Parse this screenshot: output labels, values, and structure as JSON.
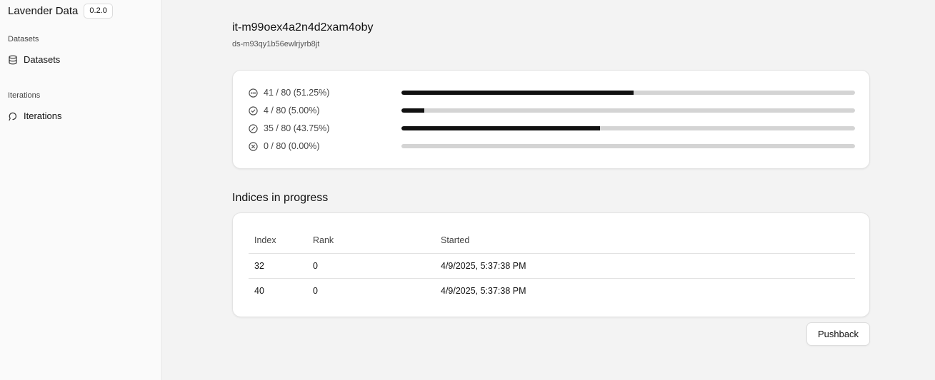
{
  "sidebar": {
    "brand_name": "Lavender Data",
    "version": "0.2.0",
    "groups": [
      {
        "label": "Datasets",
        "item_label": "Datasets",
        "icon": "database-icon"
      },
      {
        "label": "Iterations",
        "item_label": "Iterations",
        "icon": "iteration-icon"
      }
    ]
  },
  "iteration": {
    "id": "it-m99oex4a2n4d2xam4oby",
    "dataset_id": "ds-m93qy1b56ewlrjyrb8jt"
  },
  "progress": [
    {
      "status": "in-progress",
      "icon": "ellipsis-circle-icon",
      "text": "41 / 80 (51.25%)",
      "fraction": 0.5125
    },
    {
      "status": "completed",
      "icon": "check-circle-icon",
      "text": "4 / 80 (5.00%)",
      "fraction": 0.05
    },
    {
      "status": "filtered",
      "icon": "slash-circle-icon",
      "text": "35 / 80 (43.75%)",
      "fraction": 0.4375
    },
    {
      "status": "failed",
      "icon": "x-circle-icon",
      "text": "0 / 80 (0.00%)",
      "fraction": 0.0
    }
  ],
  "in_progress": {
    "title": "Indices in progress",
    "columns": [
      "Index",
      "Rank",
      "Started"
    ],
    "rows": [
      {
        "index": "32",
        "rank": "0",
        "started": "4/9/2025, 5:37:38 PM"
      },
      {
        "index": "40",
        "rank": "0",
        "started": "4/9/2025, 5:37:38 PM"
      }
    ]
  },
  "actions": {
    "pushback_label": "Pushback"
  },
  "colors": {
    "bar_fill": "#111111",
    "bar_track": "#d4d4d4",
    "sidebar_bg": "#fafafa",
    "main_bg": "#f3f3f3"
  }
}
